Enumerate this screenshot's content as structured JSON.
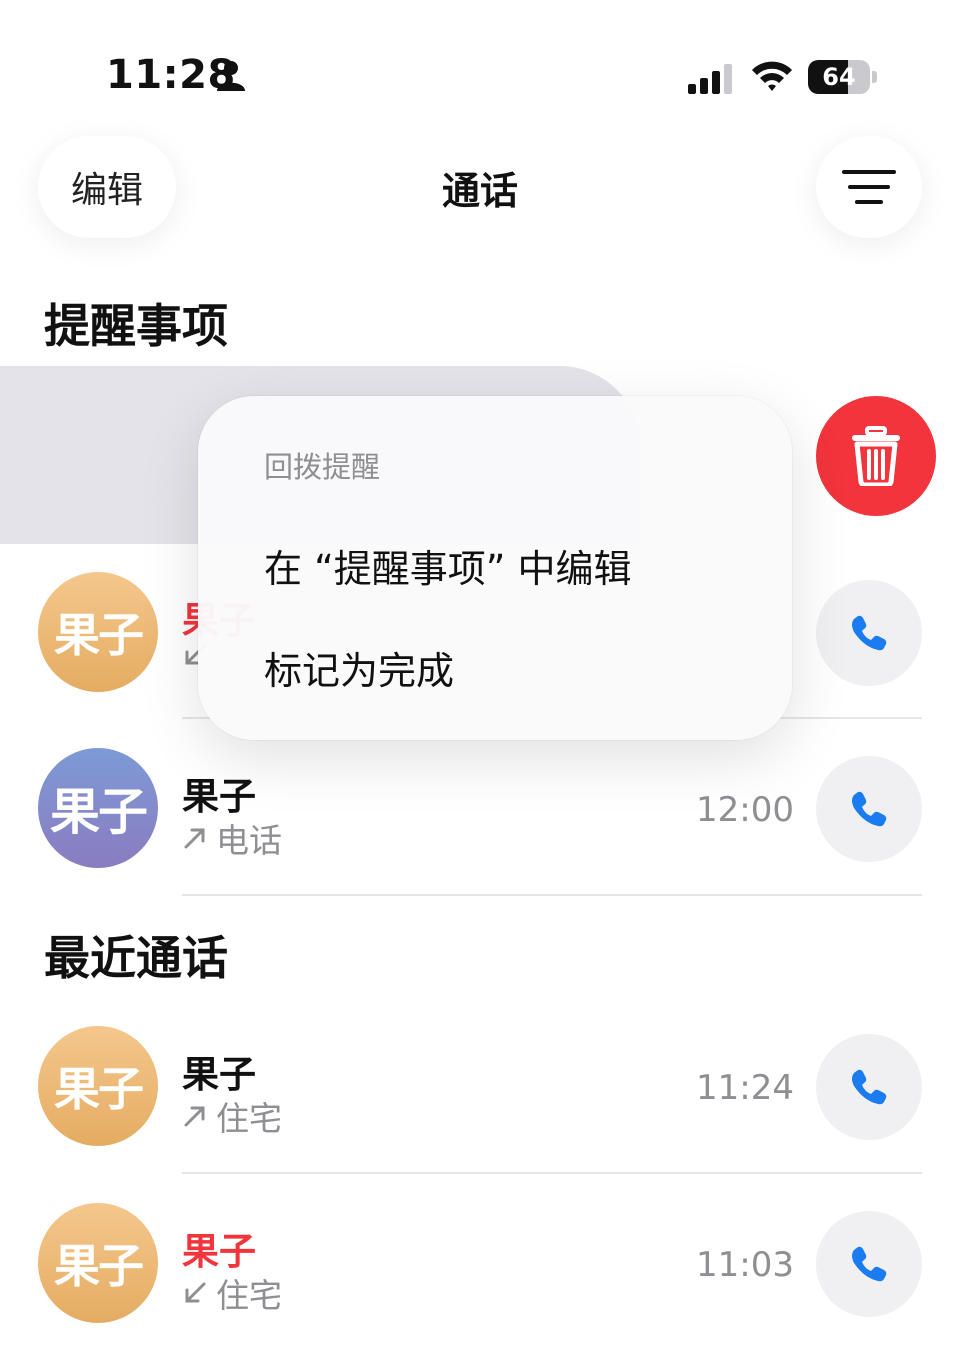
{
  "status_bar": {
    "time": "11:28",
    "battery": "64",
    "battery_level": 0.64
  },
  "nav": {
    "edit_label": "编辑",
    "title": "通话"
  },
  "sections": {
    "reminders_title": "提醒事项",
    "recents_title": "最近通话"
  },
  "context_menu": {
    "header": "回拨提醒",
    "items": [
      {
        "label": "在 “提醒事项” 中编辑"
      },
      {
        "label": "标记为完成"
      }
    ]
  },
  "calls": [
    {
      "avatar": "果子",
      "name": "果子",
      "sub": "",
      "time": "",
      "missed": true,
      "direction": "incoming"
    },
    {
      "avatar": "果子",
      "name": "果子",
      "sub": "电话",
      "time": "12:00",
      "missed": false,
      "direction": "outgoing"
    },
    {
      "avatar": "果子",
      "name": "果子",
      "sub": "住宅",
      "time": "11:24",
      "missed": false,
      "direction": "outgoing"
    },
    {
      "avatar": "果子",
      "name": "果子",
      "sub": "住宅",
      "time": "11:03",
      "missed": true,
      "direction": "incoming"
    }
  ],
  "colors": {
    "accent_blue": "#1a7cf0",
    "missed_red": "#f2343c",
    "delete_red": "#f2343c"
  },
  "icons": [
    "person-icon",
    "signal-icon",
    "wifi-icon",
    "battery-icon",
    "filter-icon",
    "trash-icon",
    "phone-icon",
    "outgoing-arrow-icon",
    "incoming-arrow-icon"
  ]
}
